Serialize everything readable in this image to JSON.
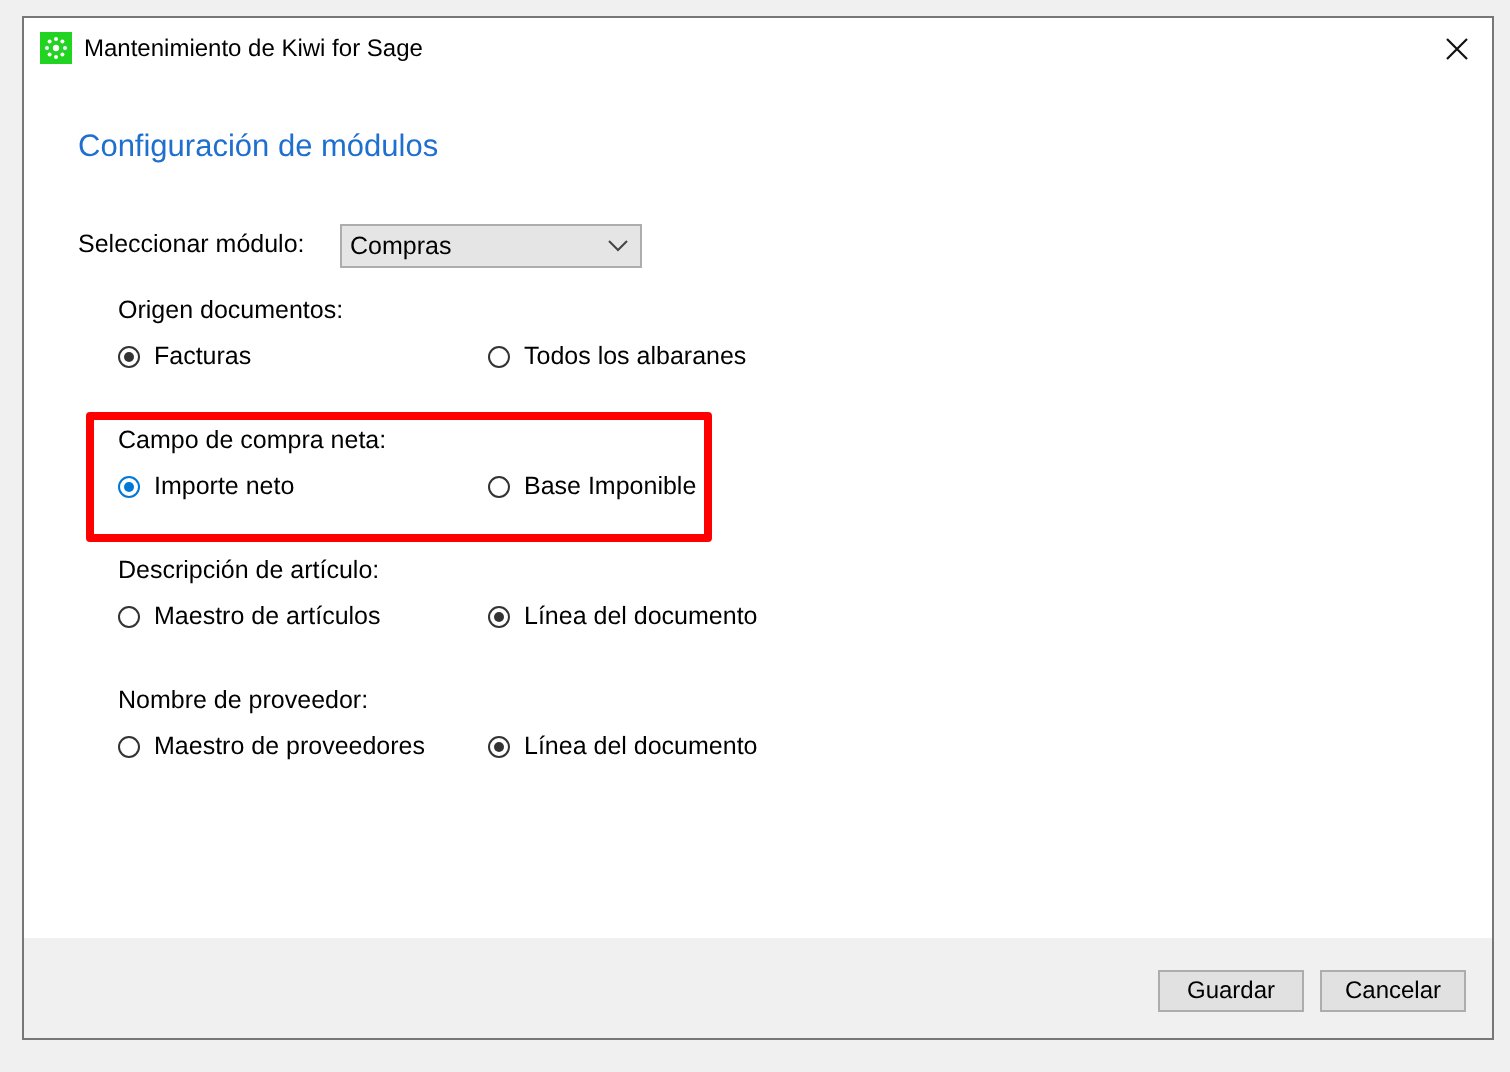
{
  "window": {
    "title": "Mantenimiento de Kiwi for Sage"
  },
  "heading": "Configuración de módulos",
  "module_select": {
    "label": "Seleccionar módulo:",
    "value": "Compras"
  },
  "groups": [
    {
      "label": "Origen documentos:",
      "highlighted": false,
      "options": [
        {
          "label": "Facturas",
          "selected": true,
          "focused": false
        },
        {
          "label": "Todos los albaranes",
          "selected": false,
          "focused": false
        }
      ]
    },
    {
      "label": "Campo de compra neta:",
      "highlighted": true,
      "options": [
        {
          "label": "Importe neto",
          "selected": true,
          "focused": true
        },
        {
          "label": "Base Imponible",
          "selected": false,
          "focused": false
        }
      ]
    },
    {
      "label": "Descripción de artículo:",
      "highlighted": false,
      "options": [
        {
          "label": "Maestro de artículos",
          "selected": false,
          "focused": false
        },
        {
          "label": "Línea del documento",
          "selected": true,
          "focused": false
        }
      ]
    },
    {
      "label": "Nombre de proveedor:",
      "highlighted": false,
      "options": [
        {
          "label": "Maestro de proveedores",
          "selected": false,
          "focused": false
        },
        {
          "label": "Línea del documento",
          "selected": true,
          "focused": false
        }
      ]
    }
  ],
  "buttons": [
    "Guardar",
    "Cancelar"
  ]
}
